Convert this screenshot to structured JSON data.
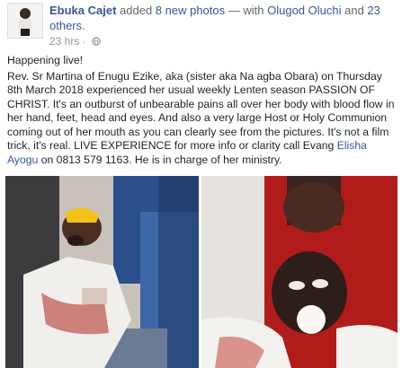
{
  "header": {
    "author": "Ebuka Cajet",
    "action_pre": " added ",
    "photo_count": "8 new photos",
    "action_mid": " — with ",
    "tagged": "Olugod Oluchi",
    "and_word": " and ",
    "others": "23 others",
    "period": ".",
    "time": "23 hrs",
    "separator": " · ",
    "privacy_icon": "globe-icon"
  },
  "post": {
    "line1": "Happening live!",
    "body_pre": "Rev. Sr Martina of Enugu Ezike, aka (sister aka Na agba Obara) on Thursday 8th March 2018 experienced her usual weekly Lenten season PASSION OF CHRIST. It's an outburst of unbearable pains all over her body with blood flow in her hand, feet, head and eyes. And also a very large Host or Holy Communion coming out of her mouth as you can clearly see from the pictures. It's not a film trick, it's real. LIVE EXPERIENCE for more info or clarity call Evang ",
    "body_link": "Elisha Ayogu",
    "body_post": " on 0813 579 1163. He is in charge of her ministry."
  },
  "colors": {
    "link": "#365899",
    "meta": "#90949c",
    "text": "#1d2129"
  }
}
